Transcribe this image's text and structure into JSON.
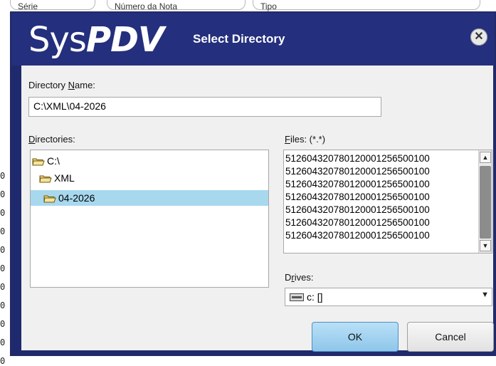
{
  "background": {
    "fields": [
      "Série",
      "Número da Nota",
      "Tipo"
    ],
    "row_marks": [
      "0",
      "0",
      "0",
      "0",
      "0",
      "0",
      "0",
      "0",
      "0",
      "0",
      "0"
    ]
  },
  "dialog": {
    "logo": {
      "sys": "Sys",
      "pdv": "PDV"
    },
    "title": "Select Directory",
    "close_symbol": "✕",
    "directory_name_label": "Directory Name:",
    "directory_name_value": "C:\\XML\\04-2026",
    "directories_label": "Directories:",
    "directories": [
      {
        "name": "C:\\",
        "depth": 0,
        "selected": false
      },
      {
        "name": "XML",
        "depth": 1,
        "selected": false
      },
      {
        "name": "04-2026",
        "depth": 2,
        "selected": true
      }
    ],
    "files_label": "Files: (*.*)",
    "files": [
      "512604320780120001256500100",
      "512604320780120001256500100",
      "512604320780120001256500100",
      "512604320780120001256500100",
      "512604320780120001256500100",
      "512604320780120001256500100",
      "512604320780120001256500100"
    ],
    "drives_label": "Drives:",
    "drive_value": "c: []",
    "ok_label": "OK",
    "cancel_label": "Cancel",
    "colors": {
      "titlebar": "#242f7d",
      "selection": "#a8d8ee",
      "ok_button": "#8fc6ea"
    }
  }
}
